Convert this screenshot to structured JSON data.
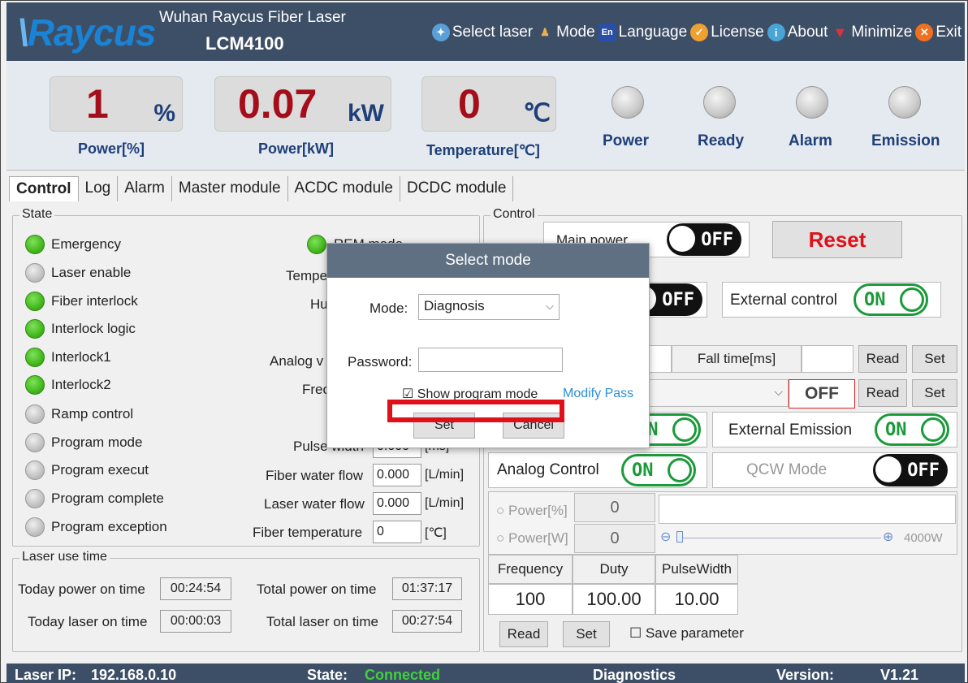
{
  "header": {
    "logo": "Raycus",
    "company": "Wuhan Raycus Fiber Laser",
    "model": "LCM4100",
    "menu": [
      {
        "label": "Select laser",
        "icon": "globe-icon"
      },
      {
        "label": "Mode",
        "icon": "users-icon"
      },
      {
        "label": "Language",
        "icon": "en-icon"
      },
      {
        "label": "License",
        "icon": "check-icon"
      },
      {
        "label": "About",
        "icon": "info-icon"
      },
      {
        "label": "Minimize",
        "icon": "minimize-icon"
      },
      {
        "label": "Exit",
        "icon": "close-icon"
      }
    ]
  },
  "metrics": [
    {
      "value": "1",
      "unit": "%",
      "label": "Power[%]"
    },
    {
      "value": "0.07",
      "unit": "kW",
      "label": "Power[kW]"
    },
    {
      "value": "0",
      "unit": "℃",
      "label": "Temperature[℃]"
    }
  ],
  "indicators": [
    "Power",
    "Ready",
    "Alarm",
    "Emission"
  ],
  "tabs": [
    "Control",
    "Log",
    "Alarm",
    "Master module",
    "ACDC module",
    "DCDC module"
  ],
  "state": {
    "title": "State",
    "left": [
      {
        "label": "Emergency",
        "on": true
      },
      {
        "label": "Laser enable",
        "on": false
      },
      {
        "label": "Fiber interlock",
        "on": true
      },
      {
        "label": "Interlock logic",
        "on": true
      },
      {
        "label": "Interlock1",
        "on": true
      },
      {
        "label": "Interlock2",
        "on": true
      },
      {
        "label": "Ramp control",
        "on": false
      },
      {
        "label": "Program mode",
        "on": false
      },
      {
        "label": "Program execut",
        "on": false
      },
      {
        "label": "Program complete",
        "on": false
      },
      {
        "label": "Program exception",
        "on": false
      }
    ],
    "rem_mode": "REM mode",
    "partial_labels": [
      "Tempe",
      "Hu",
      "Analog v",
      "Frec",
      "Pulse width"
    ],
    "pulse_value": "0.000",
    "pulse_unit": "[ms]",
    "fields": [
      {
        "label": "Fiber water flow",
        "value": "0.000",
        "unit": "[L/min]"
      },
      {
        "label": "Laser water flow",
        "value": "0.000",
        "unit": "[L/min]"
      },
      {
        "label": "Fiber temperature",
        "value": "0",
        "unit": "[℃]"
      }
    ]
  },
  "laser_use_time": {
    "title": "Laser use time",
    "today_power_label": "Today power on time",
    "today_power": "00:24:54",
    "total_power_label": "Total power on time",
    "total_power": "01:37:17",
    "today_laser_label": "Today laser on time",
    "today_laser": "00:00:03",
    "total_laser_label": "Total laser on time",
    "total_laser": "00:27:54"
  },
  "control": {
    "title": "Control",
    "main_power": "Main power",
    "main_power_state": "OFF",
    "reset": "Reset",
    "red_light_state": "OFF",
    "external_control": "External control",
    "external_control_state": "ON",
    "fall_time": "Fall time[ms]",
    "read": "Read",
    "set": "Set",
    "off_text": "OFF",
    "emission_state": "ON",
    "external_emission": "External Emission",
    "external_emission_state": "ON",
    "analog_control": "Analog Control",
    "analog_control_state": "ON",
    "qcw_mode": "QCW Mode",
    "qcw_state": "OFF",
    "power_pct_label": "Power[%]",
    "power_pct_value": "0",
    "power_w_label": "Power[W]",
    "power_w_value": "0",
    "slider_max": "4000W",
    "slider_level": 0,
    "freq_label": "Frequency",
    "duty_label": "Duty",
    "pulse_label": "PulseWidth",
    "freq_value": "100",
    "duty_value": "100.00",
    "pulse_value": "10.00",
    "save_parameter": "Save parameter"
  },
  "modal": {
    "title": "Select mode",
    "mode_label": "Mode:",
    "mode_value": "Diagnosis",
    "password_label": "Password:",
    "password_value": "",
    "show_program_mode": "Show program mode",
    "modify_pass": "Modify Pass",
    "set": "Set",
    "cancel": "Cancel"
  },
  "status": {
    "ip_label": "Laser IP:",
    "ip": "192.168.0.10",
    "state_label": "State:",
    "state": "Connected",
    "mode": "Diagnostics",
    "version_label": "Version:",
    "version": "V1.21"
  },
  "colors": {
    "header": "#3d4f66",
    "value_red": "#a40e1a",
    "label_blue": "#1e3f79",
    "on_green": "#1b9a3a",
    "connected": "#3fd13f",
    "highlight": "#e0101a"
  }
}
